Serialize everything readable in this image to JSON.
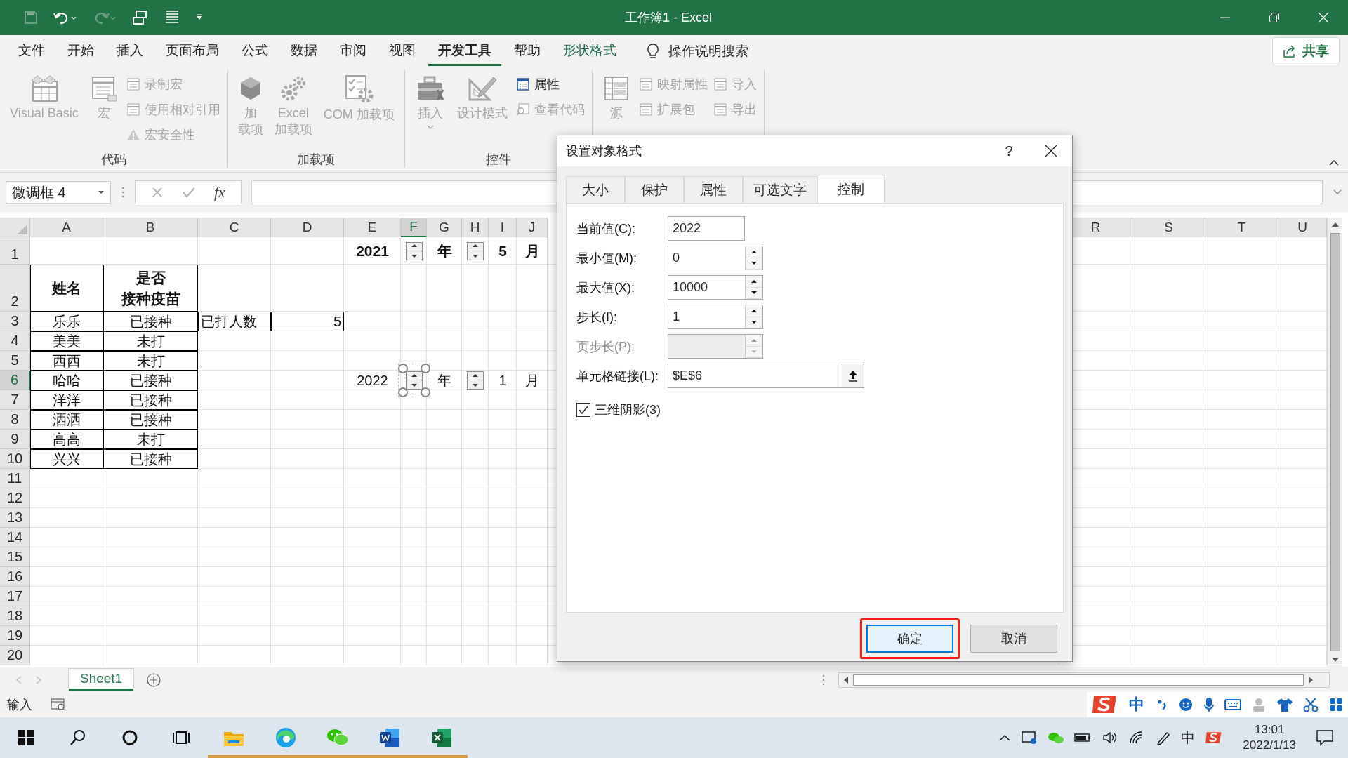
{
  "title_bar": {
    "title": "工作簿1  -  Excel"
  },
  "menu_tabs": [
    {
      "label": "文件",
      "selected": false,
      "kind": "plain"
    },
    {
      "label": "开始",
      "selected": false,
      "kind": "plain"
    },
    {
      "label": "插入",
      "selected": false,
      "kind": "plain"
    },
    {
      "label": "页面布局",
      "selected": false,
      "kind": "plain"
    },
    {
      "label": "公式",
      "selected": false,
      "kind": "plain"
    },
    {
      "label": "数据",
      "selected": false,
      "kind": "plain"
    },
    {
      "label": "审阅",
      "selected": false,
      "kind": "plain"
    },
    {
      "label": "视图",
      "selected": false,
      "kind": "plain"
    },
    {
      "label": "开发工具",
      "selected": true,
      "kind": "plain"
    },
    {
      "label": "帮助",
      "selected": false,
      "kind": "plain"
    },
    {
      "label": "形状格式",
      "selected": false,
      "kind": "contextual"
    }
  ],
  "tell_me": {
    "label": "操作说明搜索"
  },
  "share_button": {
    "label": "共享"
  },
  "ribbon_groups": [
    {
      "label": "代码",
      "items": [
        {
          "kind": "large",
          "lines": [
            "Visual Basic"
          ],
          "disabled": true
        },
        {
          "kind": "large",
          "lines": [
            "宏"
          ],
          "disabled": true
        },
        {
          "kind": "stack",
          "items": [
            {
              "label": "录制宏",
              "disabled": true
            },
            {
              "label": "使用相对引用",
              "disabled": true
            },
            {
              "label": "宏安全性",
              "disabled": true
            }
          ]
        }
      ]
    },
    {
      "label": "加载项",
      "items": [
        {
          "kind": "large",
          "lines": [
            "加",
            "载项"
          ],
          "disabled": true
        },
        {
          "kind": "large",
          "lines": [
            "Excel",
            "加载项"
          ],
          "disabled": true
        },
        {
          "kind": "large",
          "lines": [
            "COM 加载项"
          ],
          "disabled": true
        }
      ]
    },
    {
      "label": "控件",
      "items": [
        {
          "kind": "large",
          "lines": [
            "插入"
          ],
          "disabled": true,
          "has_menu": true
        },
        {
          "kind": "large",
          "lines": [
            "设计模式"
          ],
          "disabled": true
        },
        {
          "kind": "stack",
          "items": [
            {
              "label": "属性",
              "disabled": false
            },
            {
              "label": "查看代码",
              "disabled": true
            }
          ]
        }
      ]
    },
    {
      "items": [
        {
          "kind": "large",
          "lines": [
            "源"
          ],
          "disabled": true
        },
        {
          "kind": "stack",
          "items": [
            {
              "label": "映射属性",
              "disabled": true
            },
            {
              "label": "扩展包",
              "disabled": true
            }
          ]
        },
        {
          "kind": "stack",
          "items": [
            {
              "label": "导入",
              "disabled": true
            },
            {
              "label": "导出",
              "disabled": true
            }
          ]
        }
      ]
    }
  ],
  "name_box": {
    "value": "微调框 4"
  },
  "formula_bar": {
    "function_label": "fx"
  },
  "columns": [
    {
      "label": "A",
      "selected": false
    },
    {
      "label": "B",
      "selected": false
    },
    {
      "label": "C",
      "selected": false
    },
    {
      "label": "D",
      "selected": false
    },
    {
      "label": "E",
      "selected": false
    },
    {
      "label": "F",
      "selected": true
    },
    {
      "label": "G",
      "selected": false
    },
    {
      "label": "H",
      "selected": false
    },
    {
      "label": "I",
      "selected": false
    },
    {
      "label": "J",
      "selected": false
    }
  ],
  "columns_after_dialog": [
    {
      "label": "R",
      "selected": false
    },
    {
      "label": "S",
      "selected": false
    },
    {
      "label": "T",
      "selected": false
    },
    {
      "label": "U",
      "selected": false
    }
  ],
  "rows": [
    {
      "number": "1",
      "selected": false,
      "cells": [
        null,
        null,
        null,
        null,
        {
          "kind": "text",
          "text": "2021",
          "bold": true,
          "bordered": false
        },
        {
          "kind": "spinner",
          "selected": false
        },
        {
          "kind": "text",
          "text": "年",
          "bold": true,
          "bordered": false
        },
        {
          "kind": "spinner",
          "selected": false
        },
        {
          "kind": "text",
          "text": "5",
          "bold": true,
          "bordered": false
        },
        {
          "kind": "text",
          "text": "月",
          "bold": true,
          "bordered": false
        }
      ]
    },
    {
      "number": "2",
      "selected": false,
      "cells": [
        {
          "kind": "text",
          "text": "姓名",
          "bold": true,
          "bordered": true
        },
        {
          "kind": "text",
          "lines": [
            "是否",
            "接种疫苗"
          ],
          "bold": true,
          "bordered": true
        }
      ]
    },
    {
      "number": "3",
      "selected": false,
      "cells": [
        {
          "kind": "text",
          "text": "乐乐",
          "bold": false,
          "bordered": true
        },
        {
          "kind": "text",
          "text": "已接种",
          "bold": false,
          "bordered": true
        },
        {
          "kind": "label",
          "text": "已打人数",
          "bold": false,
          "bordered": true
        },
        {
          "kind": "number",
          "text": "5",
          "bold": false,
          "bordered": true
        }
      ]
    },
    {
      "number": "4",
      "selected": false,
      "cells": [
        {
          "kind": "text",
          "text": "美美",
          "bold": false,
          "bordered": true
        },
        {
          "kind": "text",
          "text": "未打",
          "bold": false,
          "bordered": true
        }
      ]
    },
    {
      "number": "5",
      "selected": false,
      "cells": [
        {
          "kind": "text",
          "text": "西西",
          "bold": false,
          "bordered": true
        },
        {
          "kind": "text",
          "text": "未打",
          "bold": false,
          "bordered": true
        }
      ]
    },
    {
      "number": "6",
      "selected": true,
      "cells": [
        {
          "kind": "text",
          "text": "哈哈",
          "bold": false,
          "bordered": true
        },
        {
          "kind": "text",
          "text": "已接种",
          "bold": false,
          "bordered": true
        },
        null,
        null,
        {
          "kind": "text",
          "text": "2022",
          "bold": false,
          "bordered": false
        },
        {
          "kind": "spinner",
          "selected": true
        },
        {
          "kind": "text",
          "text": "年",
          "bold": false,
          "bordered": false
        },
        {
          "kind": "spinner",
          "selected": false
        },
        {
          "kind": "text",
          "text": "1",
          "bold": false,
          "bordered": false
        },
        {
          "kind": "text",
          "text": "月",
          "bold": false,
          "bordered": false
        }
      ]
    },
    {
      "number": "7",
      "selected": false,
      "cells": [
        {
          "kind": "text",
          "text": "洋洋",
          "bold": false,
          "bordered": true
        },
        {
          "kind": "text",
          "text": "已接种",
          "bold": false,
          "bordered": true
        }
      ]
    },
    {
      "number": "8",
      "selected": false,
      "cells": [
        {
          "kind": "text",
          "text": "洒洒",
          "bold": false,
          "bordered": true
        },
        {
          "kind": "text",
          "text": "已接种",
          "bold": false,
          "bordered": true
        }
      ]
    },
    {
      "number": "9",
      "selected": false,
      "cells": [
        {
          "kind": "text",
          "text": "高高",
          "bold": false,
          "bordered": true
        },
        {
          "kind": "text",
          "text": "未打",
          "bold": false,
          "bordered": true
        }
      ]
    },
    {
      "number": "10",
      "selected": false,
      "cells": [
        {
          "kind": "text",
          "text": "兴兴",
          "bold": false,
          "bordered": true
        },
        {
          "kind": "text",
          "text": "已接种",
          "bold": false,
          "bordered": true
        }
      ]
    },
    {
      "number": "11",
      "selected": false
    },
    {
      "number": "12",
      "selected": false
    },
    {
      "number": "13",
      "selected": false
    },
    {
      "number": "14",
      "selected": false
    },
    {
      "number": "15",
      "selected": false
    },
    {
      "number": "16",
      "selected": false
    },
    {
      "number": "17",
      "selected": false
    },
    {
      "number": "18",
      "selected": false
    },
    {
      "number": "19",
      "selected": false
    },
    {
      "number": "20",
      "selected": false
    }
  ],
  "sheet_tabs": [
    {
      "label": "Sheet1",
      "selected": true
    }
  ],
  "status_bar": {
    "mode": "输入"
  },
  "dialog": {
    "title": "设置对象格式",
    "help": "?",
    "tabs": [
      {
        "label": "大小",
        "selected": false
      },
      {
        "label": "保护",
        "selected": false
      },
      {
        "label": "属性",
        "selected": false
      },
      {
        "label": "可选文字",
        "selected": false
      },
      {
        "label": "控制",
        "selected": true
      }
    ],
    "fields": [
      {
        "label": "当前值(C):",
        "value": "2022",
        "kind": "text",
        "disabled": false
      },
      {
        "label": "最小值(M):",
        "value": "0",
        "kind": "spin",
        "disabled": false
      },
      {
        "label": "最大值(X):",
        "value": "10000",
        "kind": "spin",
        "disabled": false
      },
      {
        "label": "步长(I):",
        "value": "1",
        "kind": "spin",
        "disabled": false
      },
      {
        "label": "页步长(P):",
        "kind": "spin",
        "disabled": true
      },
      {
        "label": "单元格链接(L):",
        "value": "$E$6",
        "kind": "reference",
        "disabled": false
      }
    ],
    "checkbox": {
      "label": "三维阴影(3)",
      "checked": true
    },
    "buttons": [
      {
        "label": "确定",
        "default": true,
        "annotated": true
      },
      {
        "label": "取消",
        "default": false,
        "annotated": false
      }
    ]
  },
  "ime_toolbar": {
    "mode": "中"
  },
  "taskbar": {
    "apps": [
      {
        "running": false
      },
      {
        "running": false
      },
      {
        "running": false
      },
      {
        "running": true
      },
      {
        "running": true
      },
      {
        "running": true
      },
      {
        "running": true
      },
      {
        "running": true
      }
    ],
    "tray": {
      "ime": "中",
      "time": "13:01",
      "date": "2022/1/13"
    }
  }
}
